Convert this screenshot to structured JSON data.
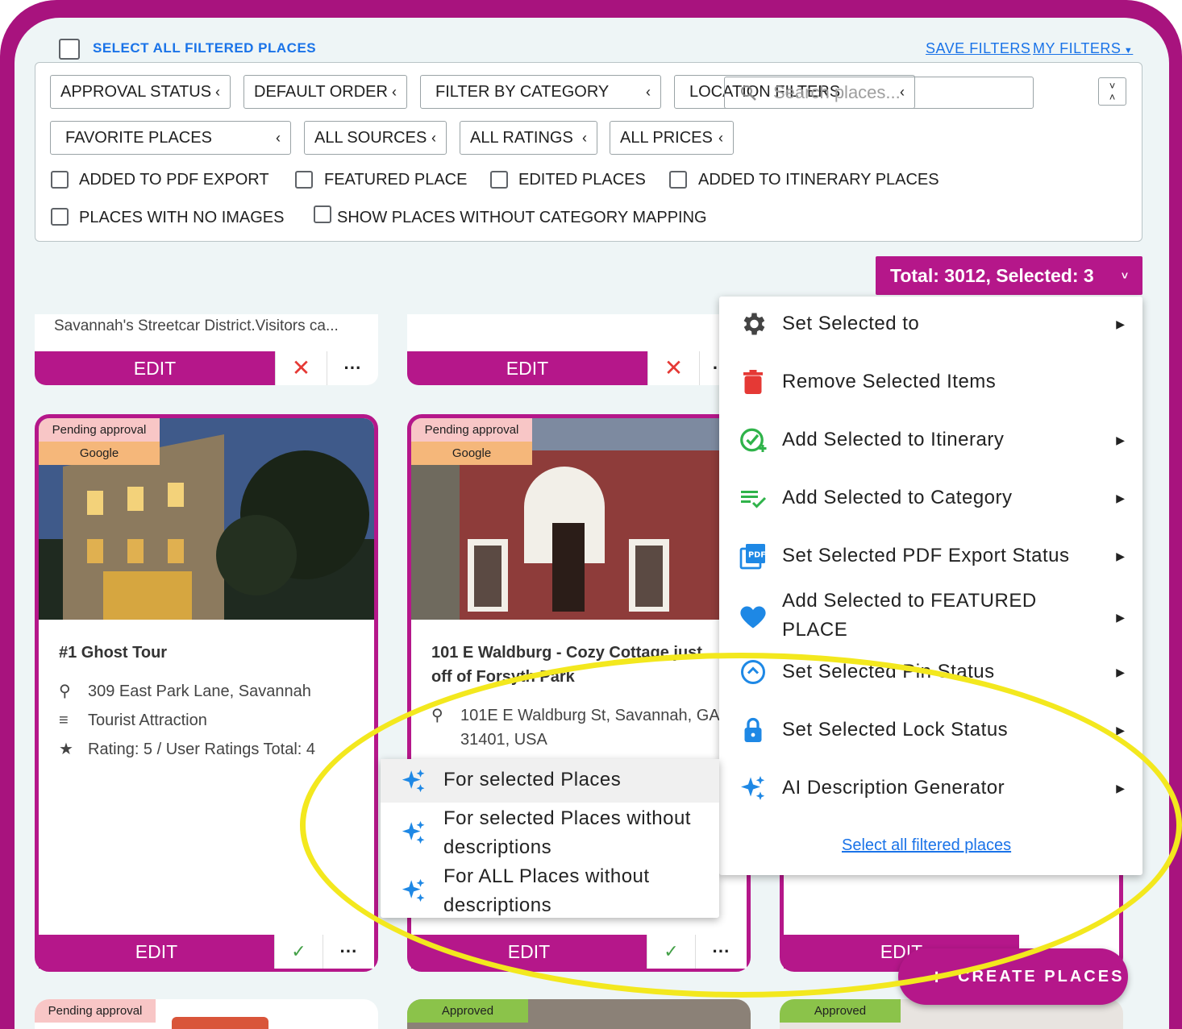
{
  "header": {
    "select_all_label": "SELECT ALL FILTERED PLACES",
    "save_filters": "SAVE FILTERS",
    "my_filters": "MY FILTERS"
  },
  "filters": {
    "approval_status": "APPROVAL STATUS",
    "default_order": "DEFAULT ORDER",
    "filter_by_category": "FILTER BY CATEGORY",
    "location_filters": "LOCATION FILTERS",
    "favorite_places": "FAVORITE PLACES",
    "all_sources": "ALL SOURCES",
    "all_ratings": "ALL RATINGS",
    "all_prices": "ALL PRICES",
    "search_placeholder": "Search places...",
    "checkboxes": [
      "ADDED TO PDF EXPORT",
      "FEATURED PLACE",
      "EDITED PLACES",
      "ADDED TO ITINERARY PLACES",
      "PLACES WITH NO IMAGES",
      "SHOW PLACES WITHOUT CATEGORY MAPPING"
    ]
  },
  "total_button": "Total: 3012, Selected: 3",
  "cards": {
    "top_left_desc": "Savannah's Streetcar District.Visitors ca...",
    "edit_label": "EDIT",
    "card1": {
      "status": "Pending approval",
      "source": "Google",
      "title": "#1 Ghost Tour",
      "address": "309 East Park Lane, Savannah",
      "category": "Tourist Attraction",
      "rating": "Rating: 5 / User Ratings Total: 4"
    },
    "card2": {
      "status": "Pending approval",
      "source": "Google",
      "title_line1": "101 E Waldburg - Cozy Cottage just",
      "title_line2": "off of Forsyth Park",
      "address_line1": "101E E Waldburg St, Savannah, GA",
      "address_line2": "31401, USA"
    },
    "card3_edit": "EDIT",
    "bottom_badges": [
      "Pending approval",
      "Approved",
      "Approved"
    ]
  },
  "menu": {
    "items": [
      "Set Selected to",
      "Remove Selected Items",
      "Add Selected to Itinerary",
      "Add Selected to Category",
      "Set Selected PDF Export Status",
      "Add Selected to FEATURED",
      "PLACE",
      "Set Selected Pin Status",
      "Set Selected Lock Status",
      "AI Description Generator"
    ],
    "footer_link": "Select all filtered places"
  },
  "submenu": {
    "item1": "For selected Places",
    "item2_line1": "For selected Places without",
    "item2_line2": "descriptions",
    "item3_line1": "For ALL Places without",
    "item3_line2": "descriptions"
  },
  "create_button": "CREATE PLACES",
  "colors": {
    "brand": "#b5178a",
    "frame": "#a8137e",
    "link": "#1a73e8",
    "highlight": "#f3e81e",
    "pending": "#f8c6c6",
    "source": "#f5b77a",
    "approved": "#8bc34a"
  }
}
